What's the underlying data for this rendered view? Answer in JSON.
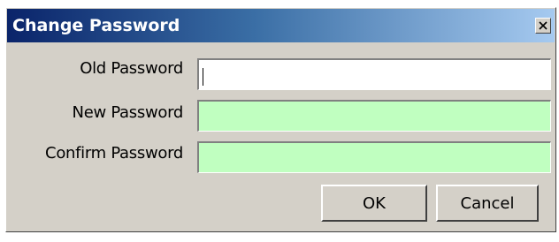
{
  "window": {
    "title": "Change Password",
    "close_icon": "close-icon"
  },
  "form": {
    "old_password_label": "Old Password",
    "old_password_value": "",
    "new_password_label": "New Password",
    "new_password_value": "",
    "confirm_password_label": "Confirm Password",
    "confirm_password_value": ""
  },
  "buttons": {
    "ok_label": "OK",
    "cancel_label": "Cancel"
  },
  "colors": {
    "dialog_bg": "#d4d0c8",
    "titlebar_start": "#0a246a",
    "titlebar_end": "#a6caf0",
    "field_required_bg": "#c0ffc0",
    "field_active_bg": "#ffffff"
  }
}
